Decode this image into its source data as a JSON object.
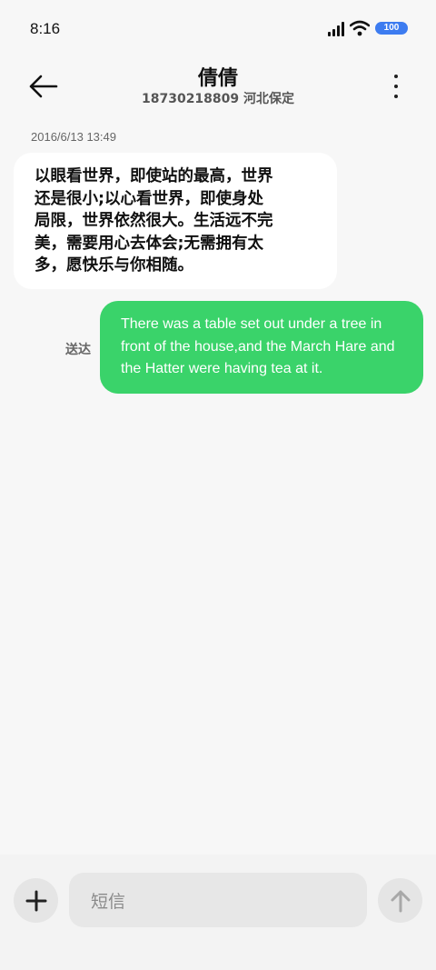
{
  "status_bar": {
    "time": "8:16",
    "battery": "100",
    "icons": [
      "signal-icon",
      "wifi-icon",
      "battery-icon"
    ]
  },
  "header": {
    "contact_name": "倩倩",
    "contact_sub": "18730218809 河北保定",
    "back_icon": "back-arrow-icon",
    "more_icon": "more-vertical-icon"
  },
  "conversation": {
    "timestamp": "2016/6/13 13:49",
    "incoming_lines": [
      "以眼看世界，即使站的最高，世界",
      "还是很小;以心看世界，即使身处",
      "局限，世界依然很大。生活远不完",
      "美，需要用心去体会;无需拥有太",
      "多，愿快乐与你相随。"
    ],
    "outgoing_lines": [
      "There was a table set out under a tree in",
      "front of the house,and the March Hare and",
      "the Hatter were having tea at it."
    ],
    "sent_status": "送达"
  },
  "input_bar": {
    "placeholder": "短信",
    "add_icon": "plus-icon",
    "send_icon": "send-arrow-icon"
  },
  "colors": {
    "outgoing_bubble": "#3ad36a",
    "incoming_bubble": "#ffffff",
    "background": "#f7f7f7",
    "battery": "#3d7cf0"
  }
}
